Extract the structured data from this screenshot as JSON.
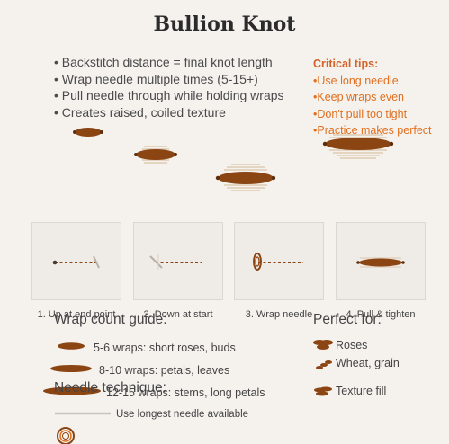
{
  "title": "Bullion Knot",
  "bullets": [
    "Backstitch distance = final knot length",
    "Wrap needle multiple times (5-15+)",
    "Pull needle through while holding wraps",
    "Creates raised, coiled texture"
  ],
  "tips": {
    "heading": "Critical tips:",
    "items": [
      "Use long needle",
      "Keep wraps even",
      "Don't pull too tight",
      "Practice makes perfect"
    ]
  },
  "steps": [
    "1. Up at end point",
    "2. Down at start",
    "3. Wrap needle",
    "4. Pull & tighten"
  ],
  "wrap_guide": {
    "heading": "Wrap count guide:",
    "items": [
      "5-6 wraps: short roses, buds",
      "8-10 wraps: petals, leaves",
      "12-15 wraps: stems, long petals"
    ]
  },
  "perfect_for": {
    "heading": "Perfect for:",
    "items": [
      "Roses",
      "Wheat, grain",
      "Texture fill"
    ]
  },
  "technique": {
    "heading": "Needle technique:",
    "items": [
      "Use longest needle available"
    ]
  },
  "colors": {
    "knot": "#8b4513",
    "knot_dark": "#5c2e0c",
    "accent": "#e07020",
    "background": "#f5f2ee"
  }
}
